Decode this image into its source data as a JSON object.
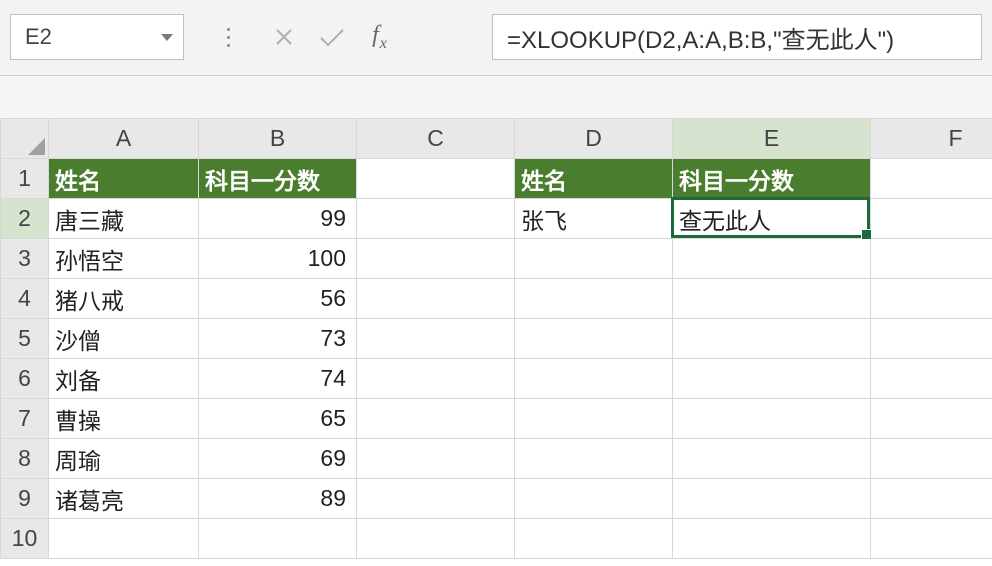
{
  "namebox": {
    "value": "E2"
  },
  "formula": {
    "value": "=XLOOKUP(D2,A:A,B:B,\"查无此人\")"
  },
  "columns": [
    "A",
    "B",
    "C",
    "D",
    "E",
    "F"
  ],
  "rows": [
    "1",
    "2",
    "3",
    "4",
    "5",
    "6",
    "7",
    "8",
    "9",
    "10"
  ],
  "headers": {
    "A1": "姓名",
    "B1": "科目一分数",
    "D1": "姓名",
    "E1": "科目一分数"
  },
  "data": {
    "A": [
      "唐三藏",
      "孙悟空",
      "猪八戒",
      "沙僧",
      "刘备",
      "曹操",
      "周瑜",
      "诸葛亮"
    ],
    "B": [
      99,
      100,
      56,
      73,
      74,
      65,
      69,
      89
    ],
    "D2": "张飞",
    "E2": "查无此人"
  },
  "active_cell": "E2",
  "colors": {
    "header_green": "#4a7d2e",
    "selection": "#1b6b3a"
  }
}
